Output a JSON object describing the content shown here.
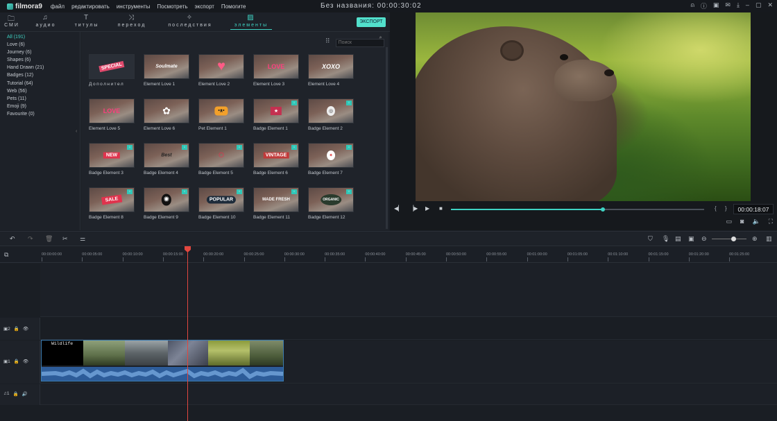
{
  "app": {
    "logo": "filmora9",
    "menu": [
      "файл",
      "редактировать",
      "инструменты",
      "Посмотреть",
      "экспорт",
      "Помогите"
    ],
    "title": "Без названия:",
    "title_time": "00:00:30:02"
  },
  "tabs": [
    {
      "label": "СМИ",
      "icon": "folder-icon"
    },
    {
      "label": "аудио",
      "icon": "music-note-icon"
    },
    {
      "label": "титулы",
      "icon": "text-icon"
    },
    {
      "label": "переход",
      "icon": "transition-icon"
    },
    {
      "label": "последствия",
      "icon": "effects-icon"
    },
    {
      "label": "элементы",
      "icon": "image-icon",
      "active": true
    }
  ],
  "export_label": "ЭКСПОРТ",
  "categories": [
    {
      "label": "All (191)",
      "selected": true
    },
    {
      "label": "Love (6)"
    },
    {
      "label": "Journey (6)"
    },
    {
      "label": "Shapes (6)"
    },
    {
      "label": "Hand Drawn (21)"
    },
    {
      "label": "Badges (12)"
    },
    {
      "label": "Tutorial (64)"
    },
    {
      "label": "Web (56)"
    },
    {
      "label": "Pets (11)"
    },
    {
      "label": "Emoji (9)"
    },
    {
      "label": "Favourite (0)"
    }
  ],
  "search_placeholder": "Поиск",
  "elements": [
    {
      "label": "Дополнител",
      "badge": "SPECIAL",
      "download": false
    },
    {
      "label": "Element Love 1",
      "badge": "Soulmate",
      "download": false
    },
    {
      "label": "Element Love 2",
      "badge": "♥",
      "download": false
    },
    {
      "label": "Element Love 3",
      "badge": "LOVE",
      "download": false
    },
    {
      "label": "Element Love 4",
      "badge": "XOXO",
      "download": false
    },
    {
      "label": "Element Love 5",
      "badge": "LOVE",
      "download": false
    },
    {
      "label": "Element Love 6",
      "badge": "✿",
      "download": false
    },
    {
      "label": "Pet Element 1",
      "badge": "•ᴥ•",
      "download": false
    },
    {
      "label": "Badge Element 1",
      "badge": "★",
      "download": true
    },
    {
      "label": "Badge Element 2",
      "badge": "◎",
      "download": true
    },
    {
      "label": "Badge Element 3",
      "badge": "NEW",
      "download": true
    },
    {
      "label": "Badge Element 4",
      "badge": "Best",
      "download": true
    },
    {
      "label": "Badge Element 5",
      "badge": "○",
      "download": true
    },
    {
      "label": "Badge Element 6",
      "badge": "VINTAGE",
      "download": true
    },
    {
      "label": "Badge Element 7",
      "badge": "✦",
      "download": true
    },
    {
      "label": "Badge Element 8",
      "badge": "SALE",
      "download": true
    },
    {
      "label": "Badge Element 9",
      "badge": "✺",
      "download": true
    },
    {
      "label": "Badge Element 10",
      "badge": "POPULAR",
      "download": true
    },
    {
      "label": "Badge Element 11",
      "badge": "MADE FRESH",
      "download": true
    },
    {
      "label": "Badge Element 12",
      "badge": "ORGANIC",
      "download": true
    }
  ],
  "player": {
    "timecode": "00:00:18:07",
    "progress": 0.6
  },
  "ruler_ticks": [
    "00:00:00:00",
    "00:00:05:00",
    "00:00:10:00",
    "00:00:15:00",
    "00:00:20:00",
    "00:00:25:00",
    "00:00:30:00",
    "00:00:35:00",
    "00:00:40:00",
    "00:00:45:00",
    "00:00:50:00",
    "00:00:55:00",
    "00:01:00:00",
    "00:01:05:00",
    "00:01:10:00",
    "00:01:15:00",
    "00:01:20:00",
    "00:01:25:00"
  ],
  "tracks": [
    {
      "label": "2",
      "type": "video"
    },
    {
      "label": "1",
      "type": "video"
    },
    {
      "label": "1",
      "type": "audio"
    }
  ],
  "clip_label": "Wildlife",
  "colors": {
    "accent": "#3fd4c4",
    "playhead": "#e2473f",
    "audio_clip": "#2d5c99"
  }
}
